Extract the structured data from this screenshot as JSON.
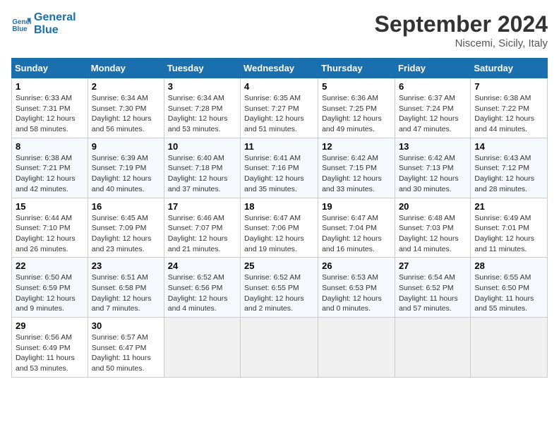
{
  "header": {
    "logo_line1": "General",
    "logo_line2": "Blue",
    "month": "September 2024",
    "location": "Niscemi, Sicily, Italy"
  },
  "days_of_week": [
    "Sunday",
    "Monday",
    "Tuesday",
    "Wednesday",
    "Thursday",
    "Friday",
    "Saturday"
  ],
  "weeks": [
    [
      {
        "day": "1",
        "sunrise": "6:33 AM",
        "sunset": "7:31 PM",
        "daylight": "12 hours and 58 minutes."
      },
      {
        "day": "2",
        "sunrise": "6:34 AM",
        "sunset": "7:30 PM",
        "daylight": "12 hours and 56 minutes."
      },
      {
        "day": "3",
        "sunrise": "6:34 AM",
        "sunset": "7:28 PM",
        "daylight": "12 hours and 53 minutes."
      },
      {
        "day": "4",
        "sunrise": "6:35 AM",
        "sunset": "7:27 PM",
        "daylight": "12 hours and 51 minutes."
      },
      {
        "day": "5",
        "sunrise": "6:36 AM",
        "sunset": "7:25 PM",
        "daylight": "12 hours and 49 minutes."
      },
      {
        "day": "6",
        "sunrise": "6:37 AM",
        "sunset": "7:24 PM",
        "daylight": "12 hours and 47 minutes."
      },
      {
        "day": "7",
        "sunrise": "6:38 AM",
        "sunset": "7:22 PM",
        "daylight": "12 hours and 44 minutes."
      }
    ],
    [
      {
        "day": "8",
        "sunrise": "6:38 AM",
        "sunset": "7:21 PM",
        "daylight": "12 hours and 42 minutes."
      },
      {
        "day": "9",
        "sunrise": "6:39 AM",
        "sunset": "7:19 PM",
        "daylight": "12 hours and 40 minutes."
      },
      {
        "day": "10",
        "sunrise": "6:40 AM",
        "sunset": "7:18 PM",
        "daylight": "12 hours and 37 minutes."
      },
      {
        "day": "11",
        "sunrise": "6:41 AM",
        "sunset": "7:16 PM",
        "daylight": "12 hours and 35 minutes."
      },
      {
        "day": "12",
        "sunrise": "6:42 AM",
        "sunset": "7:15 PM",
        "daylight": "12 hours and 33 minutes."
      },
      {
        "day": "13",
        "sunrise": "6:42 AM",
        "sunset": "7:13 PM",
        "daylight": "12 hours and 30 minutes."
      },
      {
        "day": "14",
        "sunrise": "6:43 AM",
        "sunset": "7:12 PM",
        "daylight": "12 hours and 28 minutes."
      }
    ],
    [
      {
        "day": "15",
        "sunrise": "6:44 AM",
        "sunset": "7:10 PM",
        "daylight": "12 hours and 26 minutes."
      },
      {
        "day": "16",
        "sunrise": "6:45 AM",
        "sunset": "7:09 PM",
        "daylight": "12 hours and 23 minutes."
      },
      {
        "day": "17",
        "sunrise": "6:46 AM",
        "sunset": "7:07 PM",
        "daylight": "12 hours and 21 minutes."
      },
      {
        "day": "18",
        "sunrise": "6:47 AM",
        "sunset": "7:06 PM",
        "daylight": "12 hours and 19 minutes."
      },
      {
        "day": "19",
        "sunrise": "6:47 AM",
        "sunset": "7:04 PM",
        "daylight": "12 hours and 16 minutes."
      },
      {
        "day": "20",
        "sunrise": "6:48 AM",
        "sunset": "7:03 PM",
        "daylight": "12 hours and 14 minutes."
      },
      {
        "day": "21",
        "sunrise": "6:49 AM",
        "sunset": "7:01 PM",
        "daylight": "12 hours and 11 minutes."
      }
    ],
    [
      {
        "day": "22",
        "sunrise": "6:50 AM",
        "sunset": "6:59 PM",
        "daylight": "12 hours and 9 minutes."
      },
      {
        "day": "23",
        "sunrise": "6:51 AM",
        "sunset": "6:58 PM",
        "daylight": "12 hours and 7 minutes."
      },
      {
        "day": "24",
        "sunrise": "6:52 AM",
        "sunset": "6:56 PM",
        "daylight": "12 hours and 4 minutes."
      },
      {
        "day": "25",
        "sunrise": "6:52 AM",
        "sunset": "6:55 PM",
        "daylight": "12 hours and 2 minutes."
      },
      {
        "day": "26",
        "sunrise": "6:53 AM",
        "sunset": "6:53 PM",
        "daylight": "12 hours and 0 minutes."
      },
      {
        "day": "27",
        "sunrise": "6:54 AM",
        "sunset": "6:52 PM",
        "daylight": "11 hours and 57 minutes."
      },
      {
        "day": "28",
        "sunrise": "6:55 AM",
        "sunset": "6:50 PM",
        "daylight": "11 hours and 55 minutes."
      }
    ],
    [
      {
        "day": "29",
        "sunrise": "6:56 AM",
        "sunset": "6:49 PM",
        "daylight": "11 hours and 53 minutes."
      },
      {
        "day": "30",
        "sunrise": "6:57 AM",
        "sunset": "6:47 PM",
        "daylight": "11 hours and 50 minutes."
      },
      null,
      null,
      null,
      null,
      null
    ]
  ]
}
